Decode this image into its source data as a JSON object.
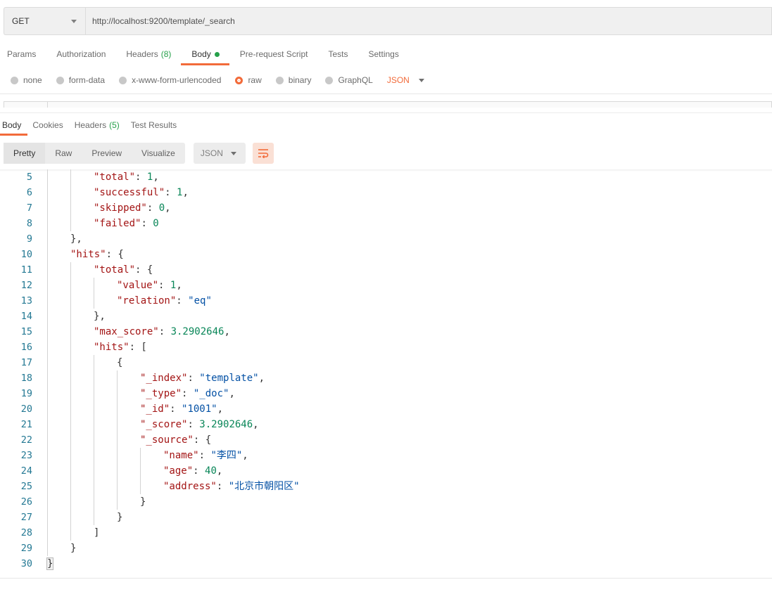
{
  "request": {
    "method": "GET",
    "url": "http://localhost:9200/template/_search"
  },
  "request_tabs": [
    {
      "label": "Params",
      "count": ""
    },
    {
      "label": "Authorization",
      "count": ""
    },
    {
      "label": "Headers",
      "count": "(8)"
    },
    {
      "label": "Body",
      "count": ""
    },
    {
      "label": "Pre-request Script",
      "count": ""
    },
    {
      "label": "Tests",
      "count": ""
    },
    {
      "label": "Settings",
      "count": ""
    }
  ],
  "body_types": [
    {
      "label": "none"
    },
    {
      "label": "form-data"
    },
    {
      "label": "x-www-form-urlencoded"
    },
    {
      "label": "raw"
    },
    {
      "label": "binary"
    },
    {
      "label": "GraphQL"
    }
  ],
  "body_format": "JSON",
  "response_tabs": [
    {
      "label": "Body",
      "count": ""
    },
    {
      "label": "Cookies",
      "count": ""
    },
    {
      "label": "Headers",
      "count": "(5)"
    },
    {
      "label": "Test Results",
      "count": ""
    }
  ],
  "view_modes": [
    "Pretty",
    "Raw",
    "Preview",
    "Visualize"
  ],
  "response_format": "JSON",
  "colors": {
    "accent": "#f26b3a",
    "success": "#26a04a",
    "json_key": "#a31515",
    "json_string": "#0451a5",
    "json_number": "#098658",
    "line_number": "#237893"
  },
  "code_lines": [
    {
      "n": "5",
      "indent": 2,
      "tokens": [
        [
          "key",
          "\"total\""
        ],
        [
          "p",
          ": "
        ],
        [
          "num",
          "1"
        ],
        [
          "p",
          ","
        ]
      ]
    },
    {
      "n": "6",
      "indent": 2,
      "tokens": [
        [
          "key",
          "\"successful\""
        ],
        [
          "p",
          ": "
        ],
        [
          "num",
          "1"
        ],
        [
          "p",
          ","
        ]
      ]
    },
    {
      "n": "7",
      "indent": 2,
      "tokens": [
        [
          "key",
          "\"skipped\""
        ],
        [
          "p",
          ": "
        ],
        [
          "num",
          "0"
        ],
        [
          "p",
          ","
        ]
      ]
    },
    {
      "n": "8",
      "indent": 2,
      "tokens": [
        [
          "key",
          "\"failed\""
        ],
        [
          "p",
          ": "
        ],
        [
          "num",
          "0"
        ]
      ]
    },
    {
      "n": "9",
      "indent": 1,
      "tokens": [
        [
          "p",
          "},"
        ]
      ]
    },
    {
      "n": "10",
      "indent": 1,
      "tokens": [
        [
          "key",
          "\"hits\""
        ],
        [
          "p",
          ": {"
        ]
      ]
    },
    {
      "n": "11",
      "indent": 2,
      "tokens": [
        [
          "key",
          "\"total\""
        ],
        [
          "p",
          ": {"
        ]
      ]
    },
    {
      "n": "12",
      "indent": 3,
      "tokens": [
        [
          "key",
          "\"value\""
        ],
        [
          "p",
          ": "
        ],
        [
          "num",
          "1"
        ],
        [
          "p",
          ","
        ]
      ]
    },
    {
      "n": "13",
      "indent": 3,
      "tokens": [
        [
          "key",
          "\"relation\""
        ],
        [
          "p",
          ": "
        ],
        [
          "str",
          "\"eq\""
        ]
      ]
    },
    {
      "n": "14",
      "indent": 2,
      "tokens": [
        [
          "p",
          "},"
        ]
      ]
    },
    {
      "n": "15",
      "indent": 2,
      "tokens": [
        [
          "key",
          "\"max_score\""
        ],
        [
          "p",
          ": "
        ],
        [
          "num",
          "3.2902646"
        ],
        [
          "p",
          ","
        ]
      ]
    },
    {
      "n": "16",
      "indent": 2,
      "tokens": [
        [
          "key",
          "\"hits\""
        ],
        [
          "p",
          ": ["
        ]
      ]
    },
    {
      "n": "17",
      "indent": 3,
      "tokens": [
        [
          "p",
          "{"
        ]
      ]
    },
    {
      "n": "18",
      "indent": 4,
      "tokens": [
        [
          "key",
          "\"_index\""
        ],
        [
          "p",
          ": "
        ],
        [
          "str",
          "\"template\""
        ],
        [
          "p",
          ","
        ]
      ]
    },
    {
      "n": "19",
      "indent": 4,
      "tokens": [
        [
          "key",
          "\"_type\""
        ],
        [
          "p",
          ": "
        ],
        [
          "str",
          "\"_doc\""
        ],
        [
          "p",
          ","
        ]
      ]
    },
    {
      "n": "20",
      "indent": 4,
      "tokens": [
        [
          "key",
          "\"_id\""
        ],
        [
          "p",
          ": "
        ],
        [
          "str",
          "\"1001\""
        ],
        [
          "p",
          ","
        ]
      ]
    },
    {
      "n": "21",
      "indent": 4,
      "tokens": [
        [
          "key",
          "\"_score\""
        ],
        [
          "p",
          ": "
        ],
        [
          "num",
          "3.2902646"
        ],
        [
          "p",
          ","
        ]
      ]
    },
    {
      "n": "22",
      "indent": 4,
      "tokens": [
        [
          "key",
          "\"_source\""
        ],
        [
          "p",
          ": {"
        ]
      ]
    },
    {
      "n": "23",
      "indent": 5,
      "tokens": [
        [
          "key",
          "\"name\""
        ],
        [
          "p",
          ": "
        ],
        [
          "str",
          "\"李四\""
        ],
        [
          "p",
          ","
        ]
      ]
    },
    {
      "n": "24",
      "indent": 5,
      "tokens": [
        [
          "key",
          "\"age\""
        ],
        [
          "p",
          ": "
        ],
        [
          "num",
          "40"
        ],
        [
          "p",
          ","
        ]
      ]
    },
    {
      "n": "25",
      "indent": 5,
      "tokens": [
        [
          "key",
          "\"address\""
        ],
        [
          "p",
          ": "
        ],
        [
          "str",
          "\"北京市朝阳区\""
        ]
      ]
    },
    {
      "n": "26",
      "indent": 4,
      "tokens": [
        [
          "p",
          "}"
        ]
      ]
    },
    {
      "n": "27",
      "indent": 3,
      "tokens": [
        [
          "p",
          "}"
        ]
      ]
    },
    {
      "n": "28",
      "indent": 2,
      "tokens": [
        [
          "p",
          "]"
        ]
      ]
    },
    {
      "n": "29",
      "indent": 1,
      "tokens": [
        [
          "p",
          "}"
        ]
      ]
    },
    {
      "n": "30",
      "indent": 0,
      "tokens": [
        [
          "p",
          "}"
        ]
      ]
    }
  ]
}
